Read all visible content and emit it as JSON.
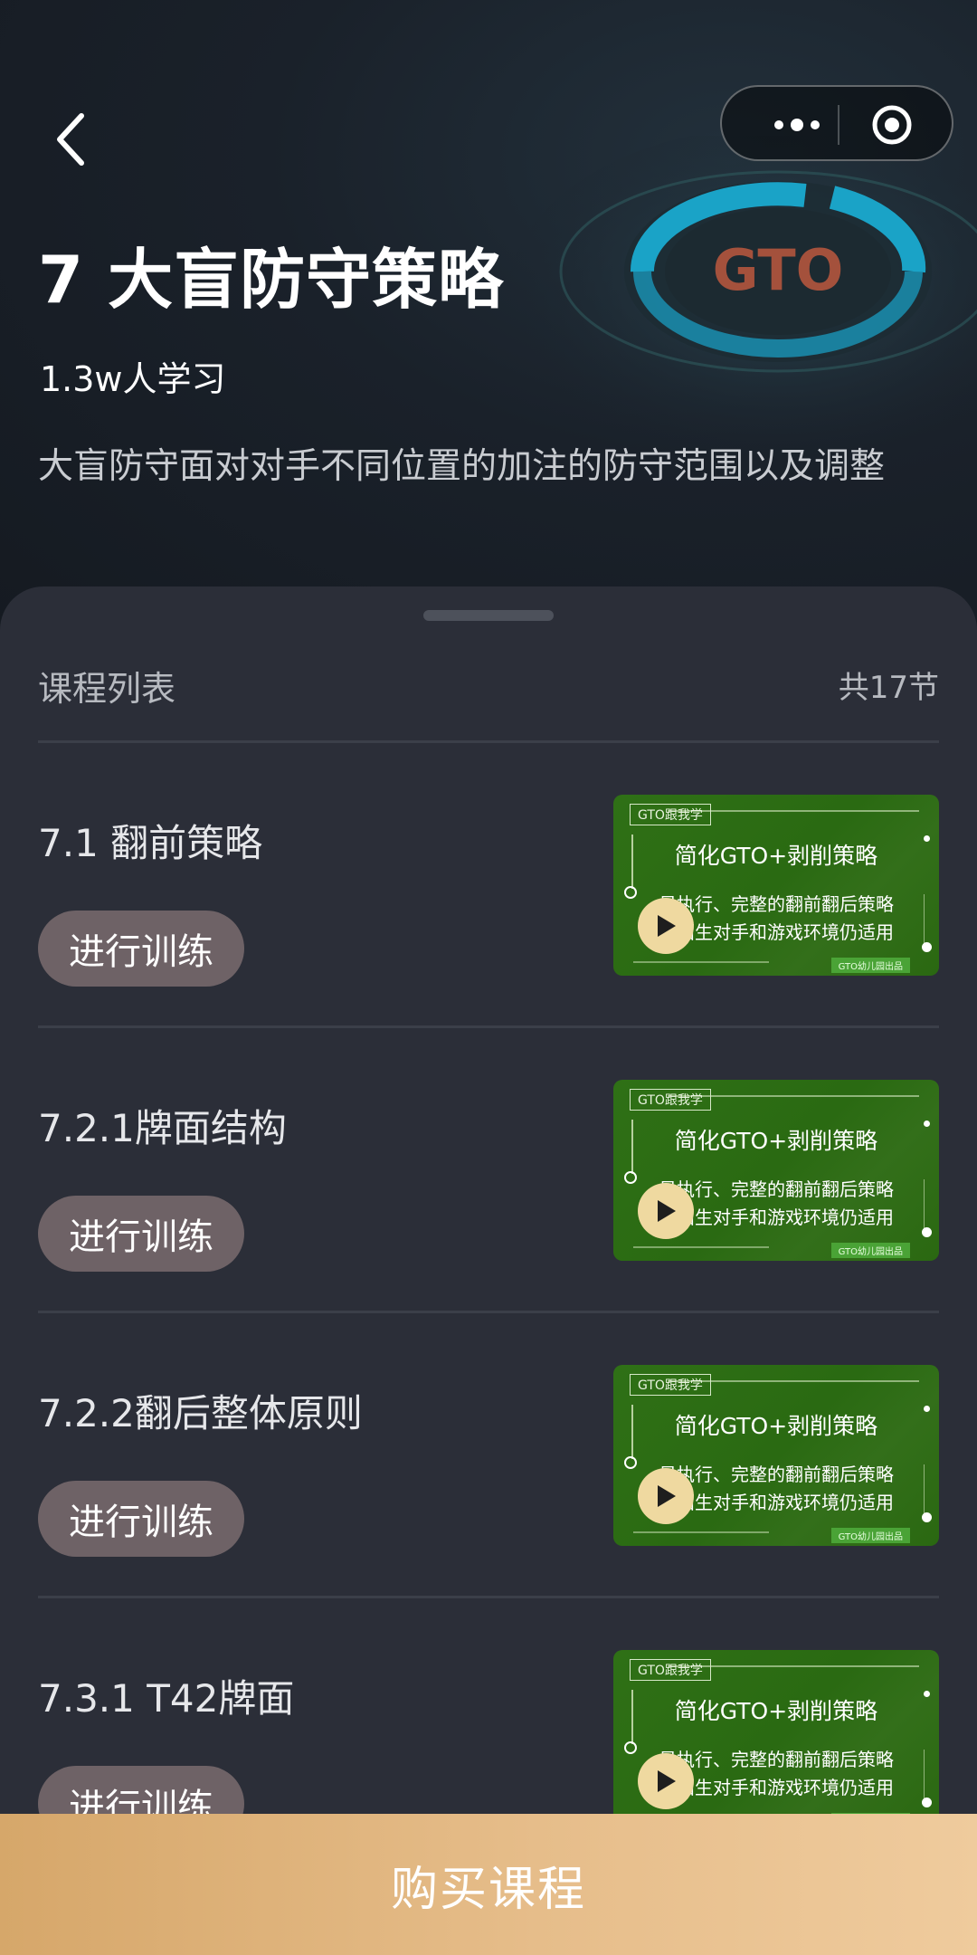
{
  "header": {
    "back_icon": "chevron-left-icon",
    "capsule": {
      "more_icon": "more-dots-icon",
      "target_icon": "target-icon"
    },
    "title": "7 大盲防守策略",
    "learners": "1.3w人学习",
    "description": "大盲防守面对对手不同位置的加注的防守范围以及调整",
    "art_text": "GTO"
  },
  "course_list": {
    "title": "课程列表",
    "count": "共17节",
    "lessons": [
      {
        "name": "7.1 翻前策略",
        "button": "进行训练"
      },
      {
        "name": "7.2.1牌面结构",
        "button": "进行训练"
      },
      {
        "name": "7.2.2翻后整体原则",
        "button": "进行训练"
      },
      {
        "name": "7.3.1 T42牌面",
        "button": "进行训练"
      }
    ],
    "thumbnail": {
      "tag": "GTO跟我学",
      "headline": "简化GTO+剥削策略",
      "line1": "易执行、完整的翻前翻后策略",
      "line2": "对陌生对手和游戏环境仍适用",
      "badge": "GTO幼儿园出品",
      "play_icon": "play-icon"
    }
  },
  "footer": {
    "buy_label": "购买课程"
  },
  "colors": {
    "accent_gold": "#e6bd8a",
    "train_button": "#6e6266",
    "thumb_green": "#2f7016"
  }
}
